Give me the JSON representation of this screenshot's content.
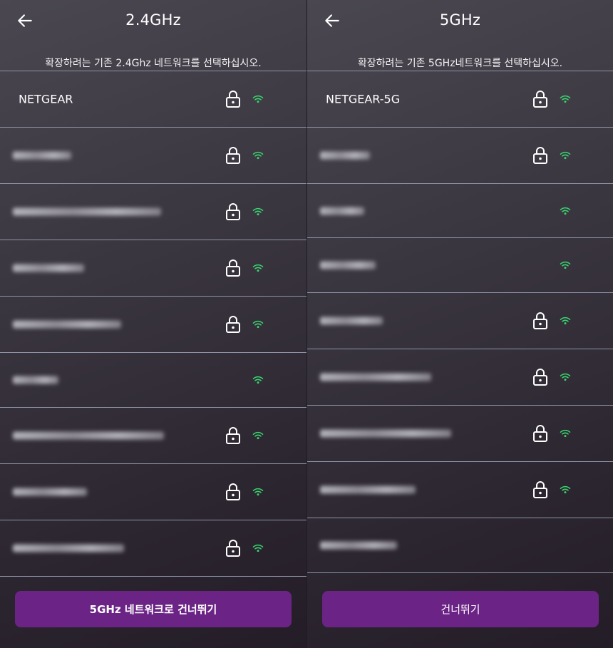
{
  "colors": {
    "accent": "#6b2485",
    "wifi": "#39d36e",
    "divider": "#8e93a6"
  },
  "left": {
    "title": "2.4GHz",
    "subtitle": "확장하려는 기존 2.4Ghz 네트워크를 선택하십시오.",
    "networks": [
      {
        "ssid": "NETGEAR",
        "locked": true,
        "signal": "wifi-icon"
      },
      {
        "ssid": "",
        "locked": true,
        "signal": "wifi-icon"
      },
      {
        "ssid": "",
        "locked": true,
        "signal": "wifi-icon"
      },
      {
        "ssid": "",
        "locked": true,
        "signal": "wifi-icon"
      },
      {
        "ssid": "",
        "locked": true,
        "signal": "wifi-icon"
      },
      {
        "ssid": "",
        "locked": false,
        "signal": "wifi-icon"
      },
      {
        "ssid": "",
        "locked": true,
        "signal": "wifi-icon"
      },
      {
        "ssid": "",
        "locked": true,
        "signal": "wifi-icon"
      },
      {
        "ssid": "",
        "locked": true,
        "signal": "wifi-icon"
      }
    ],
    "button_label": "5GHz 네트워크로 건너뛰기"
  },
  "right": {
    "title": "5GHz",
    "subtitle": "확장하려는 기존 5GHz네트워크를 선택하십시오.",
    "networks": [
      {
        "ssid": "NETGEAR-5G",
        "locked": true,
        "signal": "wifi-icon"
      },
      {
        "ssid": "",
        "locked": true,
        "signal": "wifi-icon"
      },
      {
        "ssid": "",
        "locked": false,
        "signal": "wifi-icon"
      },
      {
        "ssid": "",
        "locked": false,
        "signal": "wifi-icon"
      },
      {
        "ssid": "",
        "locked": true,
        "signal": "wifi-icon"
      },
      {
        "ssid": "",
        "locked": true,
        "signal": "wifi-icon"
      },
      {
        "ssid": "",
        "locked": true,
        "signal": "wifi-icon"
      },
      {
        "ssid": "",
        "locked": true,
        "signal": "wifi-icon"
      },
      {
        "ssid": "",
        "locked": false,
        "signal": ""
      }
    ],
    "button_label": "건너뛰기"
  }
}
